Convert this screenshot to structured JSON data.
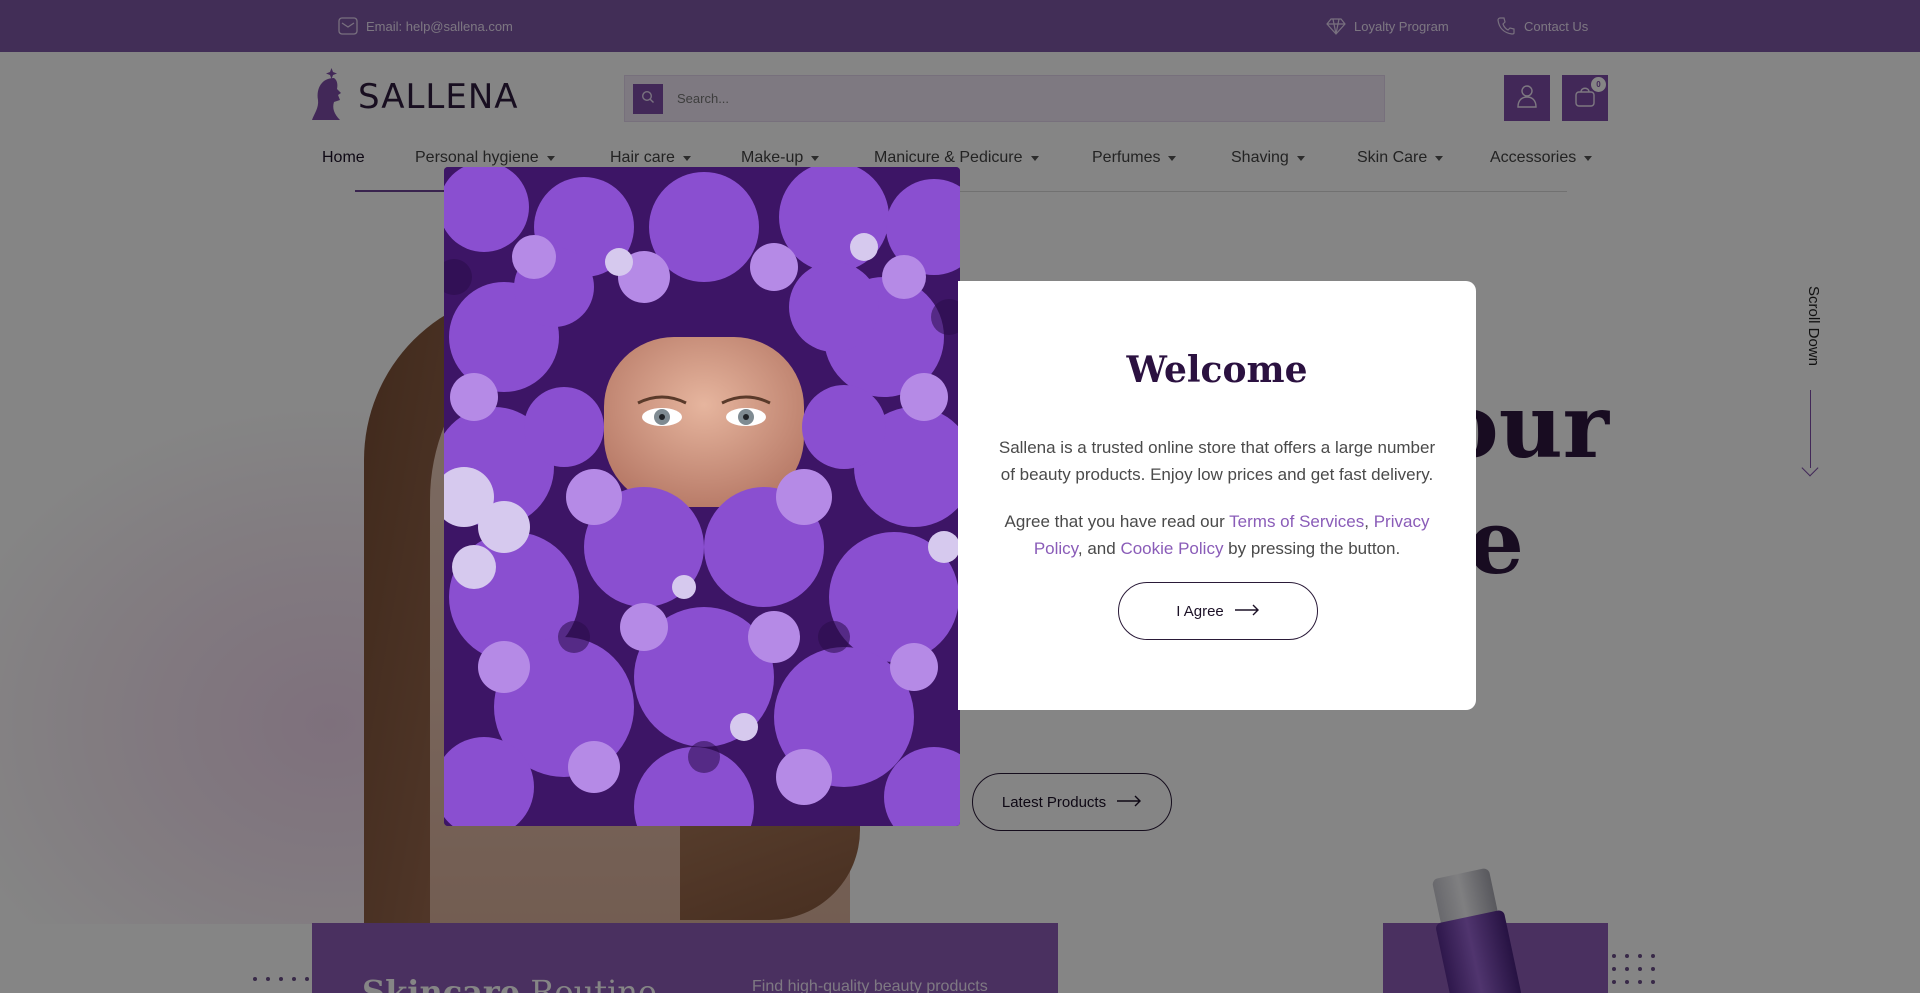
{
  "topbar": {
    "email": "Email: help@sallena.com",
    "loyalty": "Loyalty Program",
    "contact": "Contact Us"
  },
  "header": {
    "logo_text": "SALLENA",
    "search_placeholder": "Search...",
    "cart_count": "0"
  },
  "nav": {
    "items": [
      {
        "label": "Home"
      },
      {
        "label": "Personal hygiene"
      },
      {
        "label": "Hair care"
      },
      {
        "label": "Make-up"
      },
      {
        "label": "Manicure & Pedicure"
      },
      {
        "label": "Perfumes"
      },
      {
        "label": "Shaving"
      },
      {
        "label": "Skin Care"
      },
      {
        "label": "Accessories"
      }
    ]
  },
  "hero": {
    "title_line1": "our",
    "title_line2": "e",
    "latest_button": "Latest Products",
    "scroll_down": "Scroll Down"
  },
  "cards": {
    "left_title_bold": "Skincare",
    "left_title_rest": " Routine",
    "left_subtitle": "Find high-quality beauty products"
  },
  "modal": {
    "title": "Welcome",
    "description": "Sallena is a trusted online store that offers a large number of beauty products. Enjoy low prices and get fast delivery.",
    "agree_prefix": "Agree that you have read our ",
    "terms_link": "Terms of Services",
    "comma": ", ",
    "privacy_link": "Privacy Policy",
    "and_text": ", and ",
    "cookie_link": "Cookie Policy",
    "agree_suffix": " by pressing the button.",
    "agree_button": "I Agree"
  },
  "colors": {
    "brand": "#7f58a8",
    "button": "#7f4ea9",
    "heading": "#2b1140",
    "link": "#8a5cb8"
  }
}
